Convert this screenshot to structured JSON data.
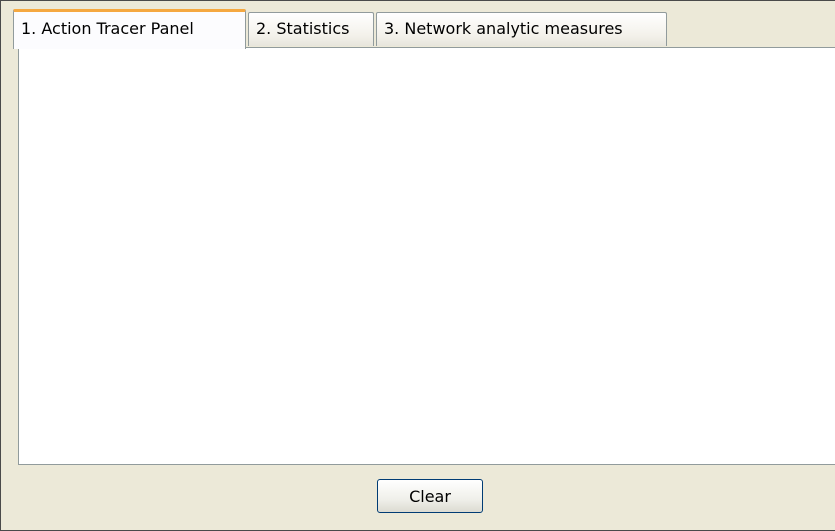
{
  "tabs": [
    {
      "label": "1. Action Tracer Panel",
      "active": true
    },
    {
      "label": "2. Statistics",
      "active": false
    },
    {
      "label": "3. Network analytic measures",
      "active": false
    }
  ],
  "footer": {
    "clear_label": "Clear"
  },
  "colors": {
    "active_tab_accent": "#f5a840",
    "window_background": "#ece9d8",
    "panel_background": "#ffffff",
    "border": "#919b9c"
  }
}
